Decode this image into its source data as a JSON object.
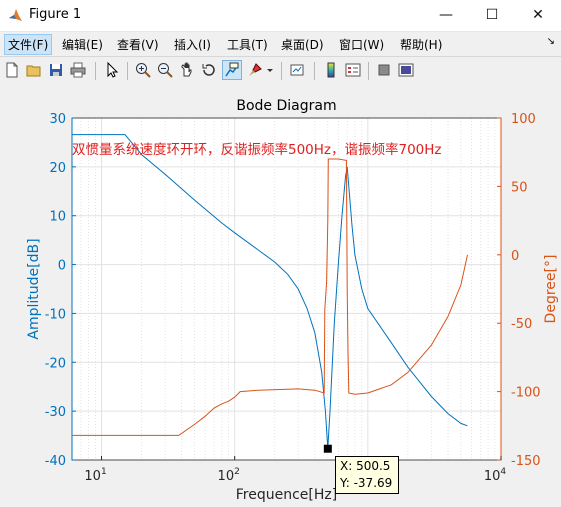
{
  "window": {
    "title": "Figure 1",
    "minimize": "—",
    "maximize": "☐",
    "close": "✕"
  },
  "menu": [
    "文件(F)",
    "编辑(E)",
    "查看(V)",
    "插入(I)",
    "工具(T)",
    "桌面(D)",
    "窗口(W)",
    "帮助(H)"
  ],
  "toolbar": {
    "icons": [
      "new-figure-icon",
      "open-file-icon",
      "save-icon",
      "print-icon",
      "pointer-icon",
      "zoom-in-icon",
      "zoom-out-icon",
      "pan-icon",
      "rotate-3d-icon",
      "data-cursor-icon",
      "brush-icon",
      "link-plot-icon",
      "colorbar-icon",
      "legend-icon",
      "hide-plot-tools-icon",
      "show-plot-tools-icon"
    ]
  },
  "chart_data": {
    "type": "line",
    "title": "Bode Diagram",
    "annotation": "双惯量系统速度环开环，反谐振频率500Hz，谐振频率700Hz",
    "xlabel": "Frequence[Hz]",
    "ylabel_left": "Amplitude[dB]",
    "ylabel_right": "Degree[°]",
    "x_scale": "log",
    "xlim": [
      6,
      10000
    ],
    "ylim_left": [
      -40,
      30
    ],
    "ylim_right": [
      -150,
      100
    ],
    "x_ticks": [
      {
        "base": "10",
        "exp": "1",
        "value": 10
      },
      {
        "base": "10",
        "exp": "2",
        "value": 100
      },
      {
        "base": "10",
        "exp": "3",
        "value": 1000
      },
      {
        "base": "10",
        "exp": "4",
        "value": 10000
      }
    ],
    "y_ticks_left": [
      30,
      20,
      10,
      0,
      -10,
      -20,
      -30,
      -40
    ],
    "y_ticks_right": [
      100,
      50,
      0,
      -50,
      -100,
      -150
    ],
    "grid": true,
    "colors": {
      "amplitude": "#0072bd",
      "phase": "#d95319",
      "annotation": "#e02020",
      "left_axis": "#0072bd",
      "right_axis": "#d95319"
    },
    "series": [
      {
        "axis": "left",
        "points": [
          [
            6,
            26.6
          ],
          [
            15,
            26.6
          ],
          [
            20,
            22.5
          ],
          [
            30,
            18.5
          ],
          [
            50,
            13.2
          ],
          [
            80,
            8.5
          ],
          [
            100,
            6.5
          ],
          [
            150,
            3
          ],
          [
            200,
            0.5
          ],
          [
            250,
            -2
          ],
          [
            300,
            -5
          ],
          [
            350,
            -9
          ],
          [
            400,
            -14
          ],
          [
            450,
            -22
          ],
          [
            480,
            -30
          ],
          [
            500.5,
            -37.69
          ],
          [
            520,
            -30
          ],
          [
            560,
            -12
          ],
          [
            600,
            0
          ],
          [
            640,
            10
          ],
          [
            680,
            18
          ],
          [
            700,
            20
          ],
          [
            720,
            16
          ],
          [
            760,
            8
          ],
          [
            800,
            2
          ],
          [
            900,
            -5
          ],
          [
            1000,
            -9
          ],
          [
            1500,
            -16
          ],
          [
            2000,
            -21
          ],
          [
            3000,
            -27
          ],
          [
            4000,
            -30.5
          ],
          [
            5000,
            -32.5
          ],
          [
            5600,
            -33
          ]
        ]
      },
      {
        "axis": "right",
        "points": [
          [
            6,
            -132
          ],
          [
            38,
            -132
          ],
          [
            50,
            -124
          ],
          [
            60,
            -118
          ],
          [
            70,
            -112
          ],
          [
            80,
            -109
          ],
          [
            90,
            -107
          ],
          [
            100,
            -104
          ],
          [
            110,
            -100
          ],
          [
            150,
            -99
          ],
          [
            300,
            -98
          ],
          [
            400,
            -99
          ],
          [
            470,
            -101
          ],
          [
            475,
            -40
          ],
          [
            490,
            -20
          ],
          [
            500,
            25
          ],
          [
            505,
            70
          ],
          [
            600,
            70
          ],
          [
            690,
            69
          ],
          [
            700,
            -25
          ],
          [
            710,
            -70
          ],
          [
            720,
            -101
          ],
          [
            800,
            -102
          ],
          [
            1000,
            -101
          ],
          [
            1500,
            -95
          ],
          [
            2000,
            -86
          ],
          [
            3000,
            -66
          ],
          [
            4000,
            -45
          ],
          [
            5000,
            -22
          ],
          [
            5600,
            0
          ]
        ]
      }
    ],
    "datatip": {
      "x_label": "X: 500.5",
      "y_label": "Y: -37.69",
      "x": 500.5,
      "y": -37.69
    }
  }
}
